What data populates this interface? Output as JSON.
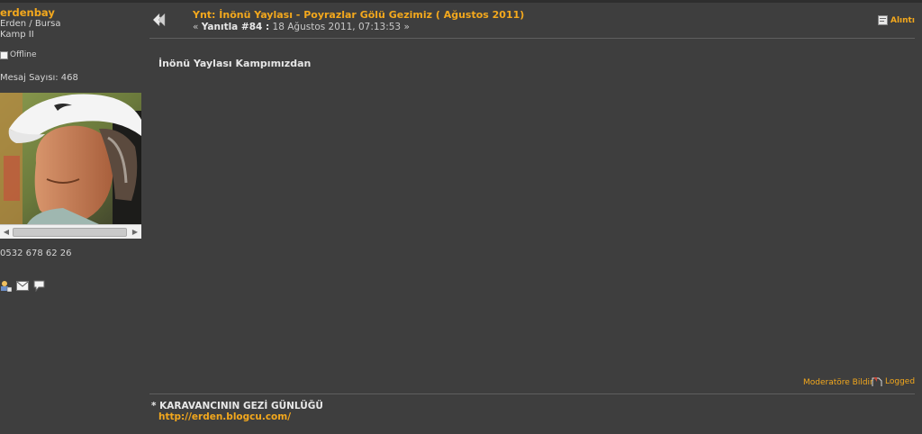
{
  "poster": {
    "username": "erdenbay",
    "location": "Erden / Bursa",
    "member_group": "Kamp II",
    "status": "Offline",
    "post_count": "Mesaj Sayısı: 468",
    "phone": "0532 678 62 26",
    "action_icons": [
      "profile-icon",
      "email-icon",
      "personal-message-icon"
    ]
  },
  "post": {
    "icon": "post-arrow-icon",
    "subject": "Ynt: İnönü Yaylası - Poyrazlar Gölü Gezimiz ( Ağustos 2011)",
    "meta_prefix": "« ",
    "reply_label": "Yanıtla #84 :",
    "date": " 18 Ağustos 2011, 07:13:53 »",
    "quote_label": "Alıntı",
    "body": "İnönü Yaylası Kampımızdan",
    "report_label": "Moderatöre Bildir",
    "logged_label": "Logged"
  },
  "signature": {
    "line1": "* KARAVANCININ GEZİ GÜNLÜĞÜ",
    "link": "http://erden.blogcu.com/"
  },
  "colors": {
    "background": "#3e3e3e",
    "link": "#f3a81d",
    "text": "#d8d8d8"
  }
}
